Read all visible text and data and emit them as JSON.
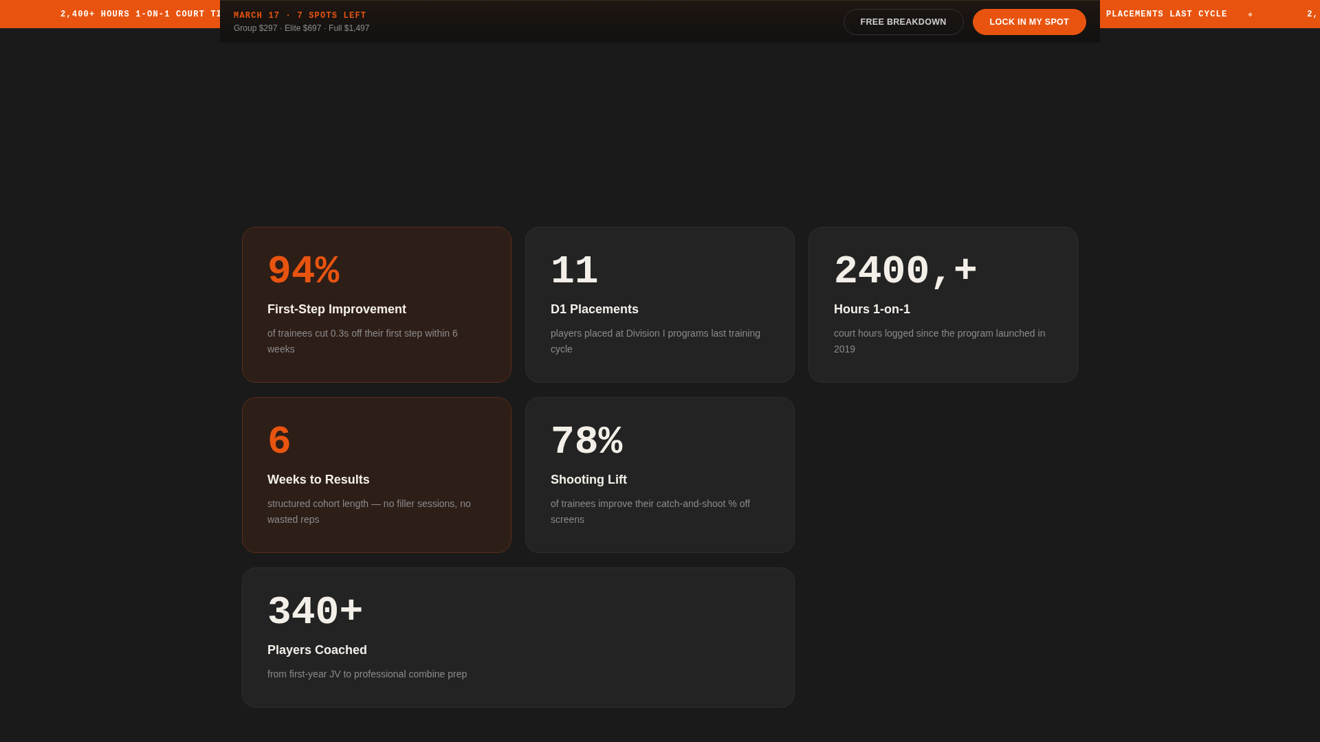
{
  "ticker": {
    "left": "2,400+ HOURS 1-ON-1 COURT TI",
    "right": "PLACEMENTS LAST CYCLE",
    "separator": "◆",
    "trailing": "2,"
  },
  "promo_bar": {
    "date": "MARCH 17 · 7 SPOTS LEFT",
    "prices": "Group $297 · Elite $697 · Full $1,497",
    "buttons": [
      {
        "label": "FREE BREAKDOWN",
        "kind": "outline"
      },
      {
        "label": "LOCK IN MY SPOT",
        "kind": "primary"
      }
    ]
  },
  "stats": [
    {
      "value": "94%",
      "title": "First-Step Improvement",
      "description": "of trainees cut 0.3s off their first step within 6 weeks",
      "accent": true,
      "wide": false
    },
    {
      "value": "11",
      "title": "D1 Placements",
      "description": "players placed at Division I programs last training cycle",
      "accent": false,
      "wide": false
    },
    {
      "value": "2400,+",
      "title": "Hours 1-on-1",
      "description": "court hours logged since the program launched in 2019",
      "accent": false,
      "wide": false
    },
    {
      "value": "6",
      "title": "Weeks to Results",
      "description": "structured cohort length — no filler sessions, no wasted reps",
      "accent": true,
      "wide": false
    },
    {
      "value": "78%",
      "title": "Shooting Lift",
      "description": "of trainees improve their catch-and-shoot % off screens",
      "accent": false,
      "wide": false
    },
    {
      "value": "340+",
      "title": "Players Coached",
      "description": "from first-year JV to professional combine prep",
      "accent": false,
      "wide": true
    }
  ]
}
